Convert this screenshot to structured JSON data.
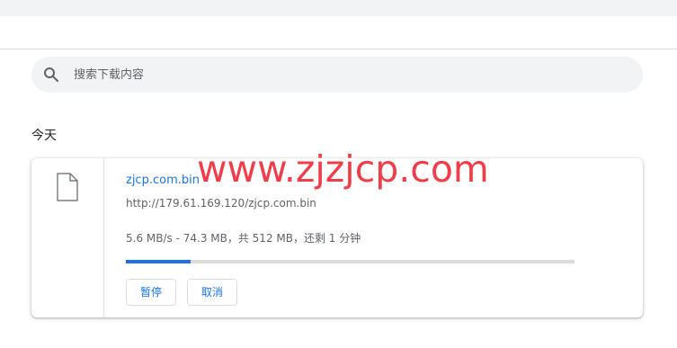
{
  "search": {
    "placeholder": "搜索下载内容",
    "icon": "search-icon"
  },
  "section": {
    "date_label": "今天"
  },
  "download": {
    "file_name": "zjcp.com.bin",
    "url": "http://179.61.169.120/zjcp.com.bin",
    "status": "5.6 MB/s - 74.3 MB，共 512 MB，还剩 1 分钟",
    "progress": 0.145,
    "icon": "file-icon",
    "pause_label": "暂停",
    "cancel_label": "取消"
  },
  "watermark": {
    "text": "www.zjzjcp.com"
  },
  "colors": {
    "accent": "#1a73e8",
    "watermark": "#ef3e4a",
    "search_bg": "#f1f3f4"
  }
}
